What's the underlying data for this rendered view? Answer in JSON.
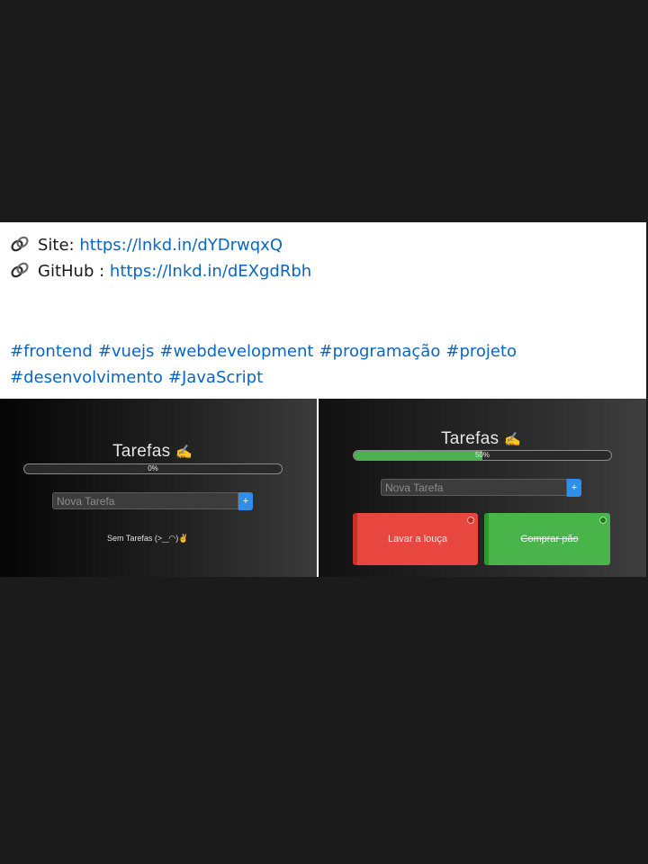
{
  "post": {
    "site_label": "Site:",
    "site_url": "https://lnkd.in/dYDrwqxQ",
    "github_label": "GitHub :",
    "github_url": "https://lnkd.in/dEXgdRbh",
    "hashtags": [
      "#frontend",
      "#vuejs",
      "#webdevelopment",
      "#programação",
      "#projeto",
      "#desenvolvimento",
      "#JavaScript"
    ]
  },
  "icons": {
    "link": "paperclip-link-icon",
    "title_emoji": "writing-hand-emoji"
  },
  "colors": {
    "link": "#0a66c2",
    "pending": "#e8473f",
    "done": "#48b449",
    "add_button": "#2f8fe8"
  },
  "shot_empty": {
    "title": "Tarefas",
    "title_emoji": "✍",
    "progress_label": "0%",
    "progress": 0,
    "input_placeholder": "Nova Tarefa",
    "add_label": "+",
    "empty_message": "Sem Tarefas (>‿◠)✌"
  },
  "shot_filled": {
    "title": "Tarefas",
    "title_emoji": "✍",
    "progress_label": "50%",
    "progress": 0.5,
    "input_placeholder": "Nova Tarefa",
    "add_label": "+",
    "tasks": [
      {
        "label": "Lavar a louça",
        "done": false
      },
      {
        "label": "Comprar pão",
        "done": true
      }
    ]
  }
}
